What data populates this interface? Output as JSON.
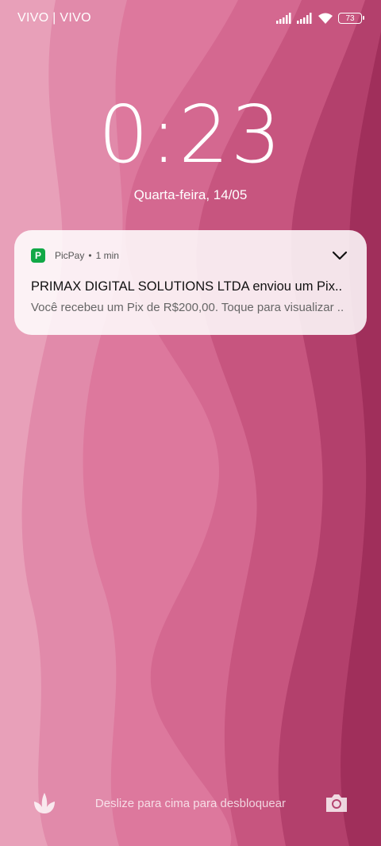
{
  "status_bar": {
    "carrier": "VIVO | VIVO",
    "battery_level": "73",
    "icons": [
      "signal-icon",
      "signal-icon",
      "wifi-icon",
      "battery-icon"
    ]
  },
  "lock_screen": {
    "time": "0:23",
    "date": "Quarta-feira, 14/05",
    "unlock_hint": "Deslize para cima para desbloquear"
  },
  "notification": {
    "app_name": "PicPay",
    "time": "1 min",
    "title": "PRIMAX DIGITAL SOLUTIONS LTDA enviou um Pix..",
    "body": "Você recebeu um Pix de R$200,00. Toque para visualizar ..",
    "app_color": "#11a846"
  },
  "bottom_bar": {
    "left_icon": "tulip-icon",
    "right_icon": "camera-icon"
  },
  "colors": {
    "wallpaper_light": "#e595b2",
    "wallpaper_mid": "#d46a90",
    "wallpaper_dark": "#a9325f"
  }
}
